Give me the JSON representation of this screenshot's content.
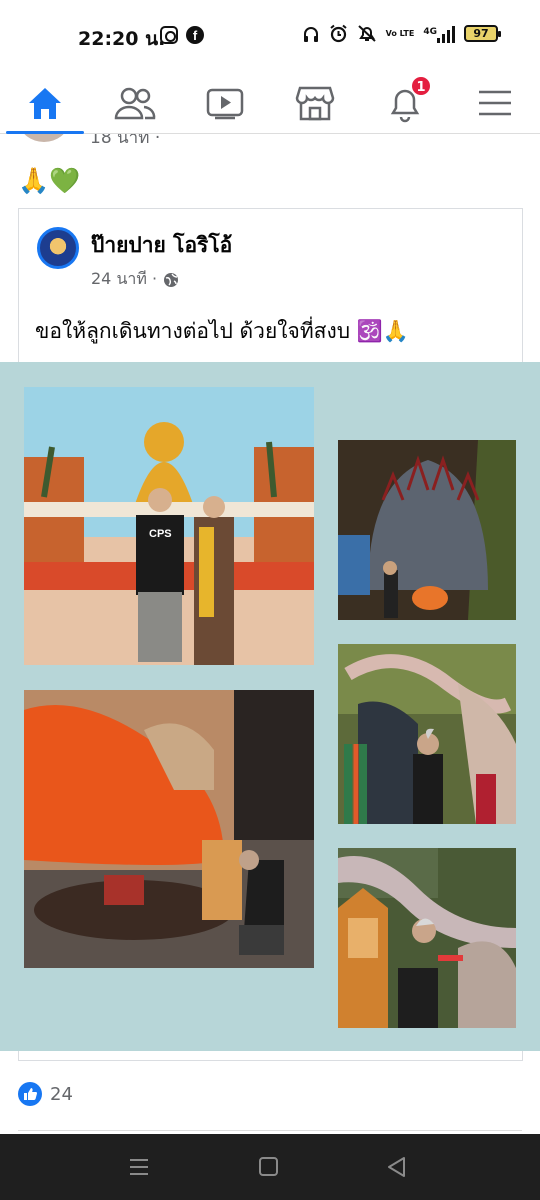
{
  "status_bar": {
    "time": "22:20 น.",
    "battery": "97",
    "network": "4G",
    "volte": "Vo LTE",
    "icons": [
      "screenshot-icon",
      "facebook-icon",
      "headphones-icon",
      "alarm-icon",
      "mute-icon",
      "volte-icon",
      "signal-icon",
      "battery-icon"
    ]
  },
  "nav": {
    "items": [
      {
        "name": "home",
        "icon": "home-icon",
        "active": true
      },
      {
        "name": "friends",
        "icon": "friends-icon"
      },
      {
        "name": "video",
        "icon": "video-icon"
      },
      {
        "name": "marketplace",
        "icon": "marketplace-icon"
      },
      {
        "name": "notifications",
        "icon": "bell-icon",
        "badge": "1"
      },
      {
        "name": "menu",
        "icon": "hamburger-icon"
      }
    ],
    "notification_badge": "1",
    "accent": "#1877f2",
    "badge_color": "#e41e3f"
  },
  "previous_post": {
    "time_partial": "18 นาที ·"
  },
  "post": {
    "emoji_caption": "🙏💚",
    "shared": {
      "author": "ป๊ายปาย โอริโอ้",
      "time": "24 นาที ·",
      "text": "ขอให้ลูกเดินทางต่อไป ด้วยใจที่สงบ 🕉️🙏"
    },
    "photos": [
      {
        "name": "photo-ganesha-couple",
        "desc_icon": "photo"
      },
      {
        "name": "photo-naga-statue"
      },
      {
        "name": "photo-ganesha-prayer"
      },
      {
        "name": "photo-dragon-garland"
      },
      {
        "name": "photo-shrine-offering"
      }
    ],
    "photo_tshirt_text": "CPS",
    "gallery_bg": "#b7d6d8",
    "like_count": "24"
  }
}
